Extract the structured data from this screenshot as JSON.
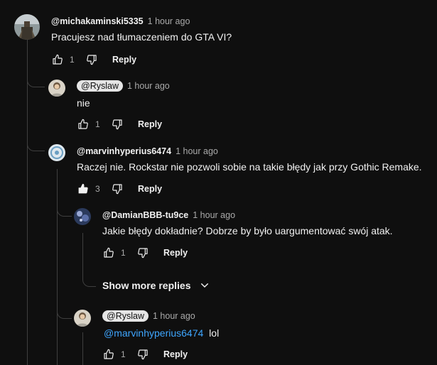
{
  "comments": [
    {
      "author": "@michakaminski5335",
      "time": "1 hour ago",
      "text": "Pracujesz nad tłumaczeniem do GTA VI?",
      "likes": "1",
      "reply_label": "Reply"
    },
    {
      "author": "@Ryslaw",
      "time": "1 hour ago",
      "text": "nie",
      "likes": "1",
      "reply_label": "Reply"
    },
    {
      "author": "@marvinhyperius6474",
      "time": "1 hour ago",
      "text": "Raczej nie. Rockstar nie pozwoli sobie na takie błędy jak przy Gothic Remake.",
      "likes": "3",
      "reply_label": "Reply"
    },
    {
      "author": "@DamianBBB-tu9ce",
      "time": "1 hour ago",
      "text": "Jakie błędy dokładnie? Dobrze by było uargumentować swój atak.",
      "likes": "1",
      "reply_label": "Reply"
    },
    {
      "author": "@Ryslaw",
      "time": "1 hour ago",
      "mention": "@marvinhyperius6474",
      "text": "lol",
      "likes": "1",
      "reply_label": "Reply"
    }
  ],
  "show_more_replies": "Show more replies",
  "icons": {
    "like": "thumb-up-icon",
    "like_filled": "thumb-up-filled-icon",
    "dislike": "thumb-down-icon",
    "chevron": "chevron-down-icon"
  },
  "colors": {
    "background": "#0f0f0f",
    "text": "#f1f1f1",
    "secondary": "#aaaaaa",
    "mention": "#3ea6ff",
    "chip": "#e5e5e5"
  }
}
